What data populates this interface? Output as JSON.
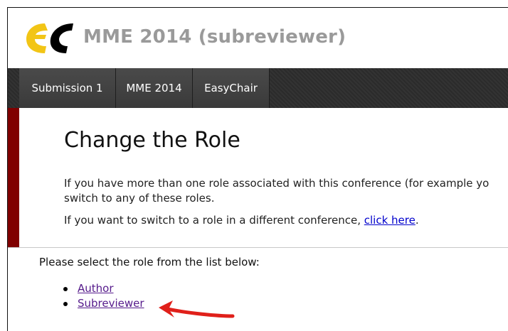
{
  "header": {
    "logo_icon": "easychair-logo",
    "title": "MME 2014 (subreviewer)"
  },
  "nav": {
    "tabs": [
      {
        "label": "Submission 1"
      },
      {
        "label": "MME 2014"
      },
      {
        "label": "EasyChair"
      }
    ]
  },
  "main": {
    "heading": "Change the Role",
    "intro_line1": "If you have more than one role associated with this conference (for example yo",
    "intro_line2": "switch to any of these roles.",
    "switch_prefix": "If you want to switch to a role in a different conference, ",
    "switch_link": "click here",
    "switch_suffix": ".",
    "select_prompt": "Please select the role from the list below:",
    "roles": [
      {
        "label": "Author"
      },
      {
        "label": "Subreviewer"
      }
    ]
  },
  "colors": {
    "accent_bar": "#800000",
    "logo_yellow": "#f2c516",
    "annotation_arrow": "#e0201a"
  }
}
